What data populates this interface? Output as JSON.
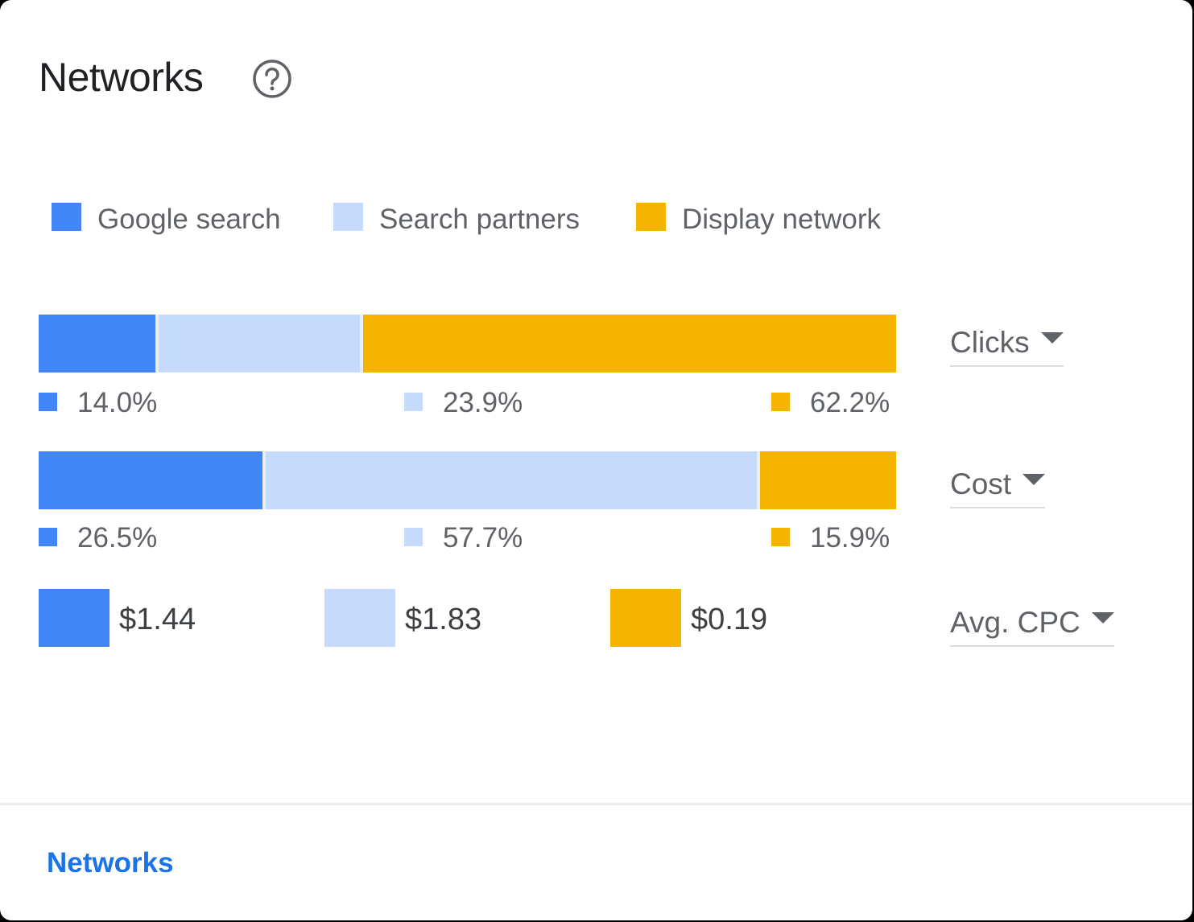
{
  "card": {
    "title": "Networks",
    "help_icon": "help-circle-icon"
  },
  "colors": {
    "google_search": "#4285f4",
    "search_partners": "#c6dafc",
    "display_network": "#f4b400"
  },
  "legend": [
    {
      "label": "Google search",
      "color": "#4285f4"
    },
    {
      "label": "Search partners",
      "color": "#c6dafc"
    },
    {
      "label": "Display network",
      "color": "#f4b400"
    }
  ],
  "chart_data": {
    "type": "bar",
    "stacked": true,
    "categories": [
      "Google search",
      "Search partners",
      "Display network"
    ],
    "series": [
      {
        "name": "Clicks",
        "values": [
          14.0,
          23.9,
          62.2
        ],
        "labels": [
          "14.0%",
          "23.9%",
          "62.2%"
        ]
      },
      {
        "name": "Cost",
        "values": [
          26.5,
          57.7,
          15.9
        ],
        "labels": [
          "26.5%",
          "57.7%",
          "15.9%"
        ]
      }
    ],
    "avg_cpc": {
      "name": "Avg. CPC",
      "values": [
        1.44,
        1.83,
        0.19
      ],
      "labels": [
        "$1.44",
        "$1.83",
        "$0.19"
      ]
    }
  },
  "metric_selectors": {
    "clicks": "Clicks",
    "cost": "Cost",
    "avg_cpc": "Avg. CPC"
  },
  "footer": {
    "link_label": "Networks"
  }
}
